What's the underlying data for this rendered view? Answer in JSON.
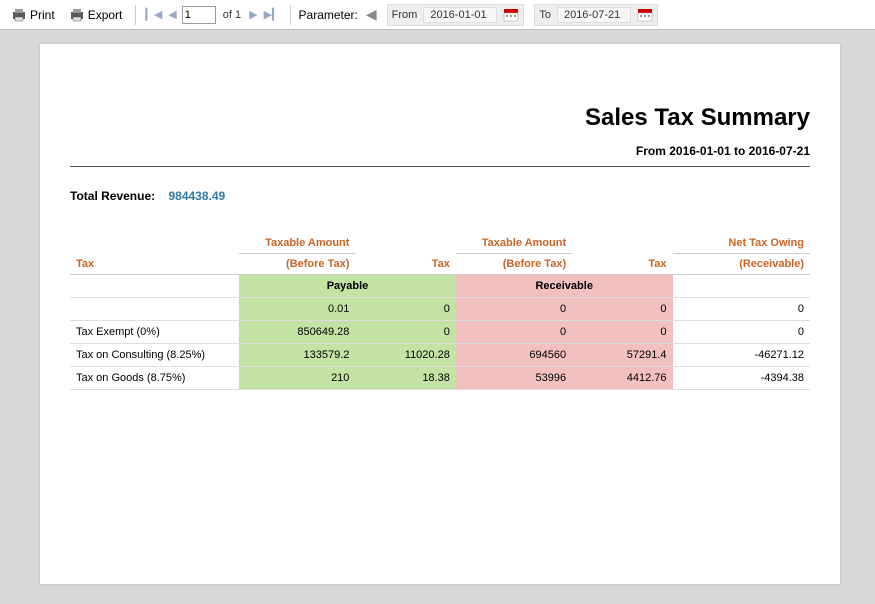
{
  "toolbar": {
    "print_label": "Print",
    "export_label": "Export",
    "page_value": "1",
    "page_of": "of 1",
    "param_label": "Parameter:",
    "from_label": "From",
    "from_value": "2016-01-01",
    "to_label": "To",
    "to_value": "2016-07-21"
  },
  "report": {
    "title": "Sales Tax Summary",
    "subtitle": "From 2016-01-01 to 2016-07-21",
    "total_label": "Total Revenue:",
    "total_value": "984438.49",
    "headers": {
      "tax": "Tax",
      "taxable_before": "Taxable Amount",
      "taxable_before2": "(Before Tax)",
      "tax_col": "Tax",
      "net_owing": "Net Tax Owing",
      "receivable": "(Receivable)"
    },
    "sections": {
      "payable": "Payable",
      "receivable": "Receivable"
    },
    "rows": [
      {
        "label": "",
        "pa": "0.01",
        "pt": "0",
        "ra": "0",
        "rt": "0",
        "net": "0"
      },
      {
        "label": "Tax Exempt (0%)",
        "pa": "850649.28",
        "pt": "0",
        "ra": "0",
        "rt": "0",
        "net": "0"
      },
      {
        "label": "Tax on Consulting (8.25%)",
        "pa": "133579.2",
        "pt": "11020.28",
        "ra": "694560",
        "rt": "57291.4",
        "net": "-46271.12"
      },
      {
        "label": "Tax on Goods (8.75%)",
        "pa": "210",
        "pt": "18.38",
        "ra": "53996",
        "rt": "4412.76",
        "net": "-4394.38"
      }
    ]
  }
}
